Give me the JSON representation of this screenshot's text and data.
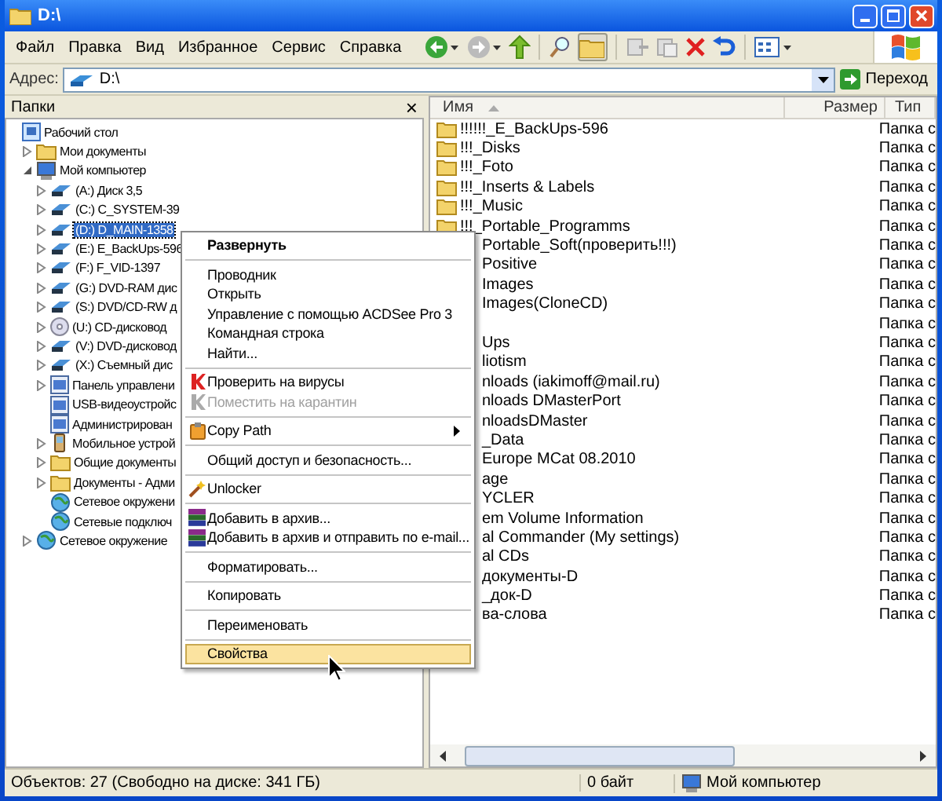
{
  "window": {
    "title": "D:\\"
  },
  "menu": [
    "Файл",
    "Правка",
    "Вид",
    "Избранное",
    "Сервис",
    "Справка"
  ],
  "toolbar": {
    "folders_selected": true
  },
  "address": {
    "label": "Адрес:",
    "value": "D:\\",
    "go": "Переход"
  },
  "folders_pane": {
    "title": "Папки",
    "close": "×"
  },
  "tree": [
    {
      "label": "Рабочий стол",
      "selected": false,
      "children": [
        {
          "label": "Мои документы",
          "selected": false,
          "expanded": false
        },
        {
          "label": "Мой компьютер",
          "selected": false,
          "expanded": true,
          "children": [
            {
              "label": "(A:) Диск 3,5",
              "selected": false,
              "expanded": false
            },
            {
              "label": "(C:) C_SYSTEM-39",
              "selected": false,
              "expanded": false
            },
            {
              "label": "(D:) D_MAIN-1358",
              "selected": true,
              "expanded": false
            },
            {
              "label": "(E:) E_BackUps-596",
              "selected": false,
              "expanded": false
            },
            {
              "label": "(F:) F_VID-1397",
              "selected": false,
              "expanded": false
            },
            {
              "label": "(G:) DVD-RAM дис",
              "selected": false,
              "expanded": false
            },
            {
              "label": "(S:) DVD/CD-RW д",
              "selected": false,
              "expanded": false
            },
            {
              "label": "(U:) CD-дисковод",
              "selected": false,
              "expanded": false
            },
            {
              "label": "(V:) DVD-дисковод",
              "selected": false,
              "expanded": false
            },
            {
              "label": "(X:) Съемный дис",
              "selected": false,
              "expanded": false
            },
            {
              "label": "Панель управлени",
              "selected": false,
              "expanded": false
            },
            {
              "label": "USB-видеоустройс",
              "selected": false
            },
            {
              "label": "Администрирован",
              "selected": false
            },
            {
              "label": "Мобильное устрой",
              "selected": false,
              "expanded": false
            },
            {
              "label": "Общие документы",
              "selected": false,
              "expanded": false
            },
            {
              "label": "Документы - Адми",
              "selected": false,
              "expanded": false
            },
            {
              "label": "Сетевое окружени",
              "selected": false
            },
            {
              "label": "Сетевые подключ",
              "selected": false
            }
          ]
        },
        {
          "label": "Сетевое окружение",
          "selected": false,
          "expanded": false
        }
      ]
    }
  ],
  "columns": [
    "Имя",
    "Размер",
    "Тип"
  ],
  "files": [
    {
      "name": "!!!!!!_E_BackUps-596",
      "type": "Папка с",
      "covered": false
    },
    {
      "name": "!!!_Disks",
      "type": "Папка с",
      "covered": false
    },
    {
      "name": "!!!_Foto",
      "type": "Папка с",
      "covered": false
    },
    {
      "name": "!!!_Inserts & Labels",
      "type": "Папка с",
      "covered": false
    },
    {
      "name": "!!!_Music",
      "type": "Папка с",
      "covered": false
    },
    {
      "name": "!!!_Portable_Programms",
      "type": "Папка с",
      "covered": false
    },
    {
      "name": "Portable_Soft(проверить!!!)",
      "type": "Папка с",
      "covered": true
    },
    {
      "name": "Positive",
      "type": "Папка с",
      "covered": true
    },
    {
      "name": "Images",
      "type": "Папка с",
      "covered": true
    },
    {
      "name": "Images(CloneCD)",
      "type": "Папка с",
      "covered": true
    },
    {
      "type": "Папка с"
    },
    {
      "name": "Ups",
      "type": "Папка с",
      "covered": true
    },
    {
      "name": "liotism",
      "type": "Папка с",
      "covered": true
    },
    {
      "name": "nloads (iakimoff@mail.ru)",
      "type": "Папка с",
      "covered": true
    },
    {
      "name": "nloads DMasterPort",
      "type": "Папка с",
      "covered": true
    },
    {
      "name": "nloadsDMaster",
      "type": "Папка с",
      "covered": true
    },
    {
      "name": "_Data",
      "type": "Папка с",
      "covered": true
    },
    {
      "name": "Europe MCat 08.2010",
      "type": "Папка с",
      "covered": true
    },
    {
      "name": "age",
      "type": "Папка с",
      "covered": true
    },
    {
      "name": "YCLER",
      "type": "Папка с",
      "covered": true
    },
    {
      "name": "em Volume Information",
      "type": "Папка с",
      "covered": true
    },
    {
      "name": "al Commander (My settings)",
      "type": "Папка с",
      "covered": true
    },
    {
      "name": "al CDs",
      "type": "Папка с",
      "covered": true
    },
    {
      "name": "документы-D",
      "type": "Папка с",
      "covered": true
    },
    {
      "name": "_док-D",
      "type": "Папка с",
      "covered": true
    },
    {
      "name": "ва-слова",
      "type": "Папка с",
      "covered": true
    }
  ],
  "context_menu": [
    {
      "kind": "item",
      "label": "Развернуть",
      "bold": true,
      "disabled": false,
      "selected": false,
      "submenu": false
    },
    {
      "kind": "separator"
    },
    {
      "kind": "item",
      "label": "Проводник",
      "bold": false,
      "disabled": false,
      "selected": false,
      "submenu": false
    },
    {
      "kind": "item",
      "label": "Открыть",
      "bold": false,
      "disabled": false,
      "selected": false,
      "submenu": false
    },
    {
      "kind": "item",
      "label": "Управление с помощью ACDSee Pro 3",
      "bold": false,
      "disabled": false,
      "selected": false,
      "submenu": false
    },
    {
      "kind": "item",
      "label": "Командная строка",
      "bold": false,
      "disabled": false,
      "selected": false,
      "submenu": false
    },
    {
      "kind": "item",
      "label": "Найти...",
      "bold": false,
      "disabled": false,
      "selected": false,
      "submenu": false
    },
    {
      "kind": "separator"
    },
    {
      "kind": "item",
      "label": "Проверить на вирусы",
      "bold": false,
      "disabled": false,
      "selected": false,
      "submenu": false
    },
    {
      "kind": "item",
      "label": "Поместить на карантин",
      "bold": false,
      "disabled": true,
      "selected": false,
      "submenu": false
    },
    {
      "kind": "separator"
    },
    {
      "kind": "item",
      "label": "Copy Path",
      "bold": false,
      "disabled": false,
      "selected": false,
      "submenu": true
    },
    {
      "kind": "separator"
    },
    {
      "kind": "item",
      "label": "Общий доступ и безопасность...",
      "bold": false,
      "disabled": false,
      "selected": false,
      "submenu": false
    },
    {
      "kind": "separator"
    },
    {
      "kind": "item",
      "label": "Unlocker",
      "bold": false,
      "disabled": false,
      "selected": false,
      "submenu": false
    },
    {
      "kind": "separator"
    },
    {
      "kind": "item",
      "label": "Добавить в архив...",
      "bold": false,
      "disabled": false,
      "selected": false,
      "submenu": false
    },
    {
      "kind": "item",
      "label": "Добавить в архив и отправить по e-mail...",
      "bold": false,
      "disabled": false,
      "selected": false,
      "submenu": false
    },
    {
      "kind": "separator"
    },
    {
      "kind": "item",
      "label": "Форматировать...",
      "bold": false,
      "disabled": false,
      "selected": false,
      "submenu": false
    },
    {
      "kind": "separator"
    },
    {
      "kind": "item",
      "label": "Копировать",
      "bold": false,
      "disabled": false,
      "selected": false,
      "submenu": false
    },
    {
      "kind": "separator"
    },
    {
      "kind": "item",
      "label": "Переименовать",
      "bold": false,
      "disabled": false,
      "selected": false,
      "submenu": false
    },
    {
      "kind": "separator"
    },
    {
      "kind": "item",
      "label": "Свойства",
      "bold": false,
      "disabled": false,
      "selected": true,
      "submenu": false
    }
  ],
  "status_bar": {
    "objects": "Объектов: 27 (Свободно на диске: 341 ГБ)",
    "size": "0 байт",
    "location": "Мой компьютер"
  }
}
